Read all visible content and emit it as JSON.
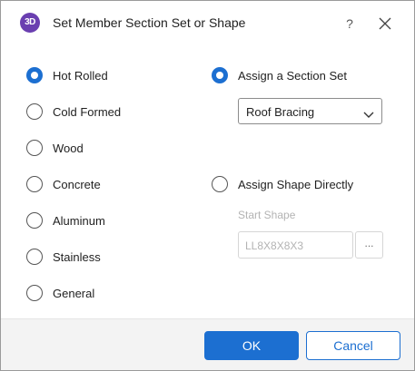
{
  "window": {
    "app_icon_text": "3D",
    "title": "Set Member Section Set or Shape",
    "help_label": "?"
  },
  "material_options": [
    {
      "label": "Hot Rolled",
      "checked": true
    },
    {
      "label": "Cold Formed",
      "checked": false
    },
    {
      "label": "Wood",
      "checked": false
    },
    {
      "label": "Concrete",
      "checked": false
    },
    {
      "label": "Aluminum",
      "checked": false
    },
    {
      "label": "Stainless",
      "checked": false
    },
    {
      "label": "General",
      "checked": false
    }
  ],
  "assign_section_set": {
    "label": "Assign a Section Set",
    "checked": true,
    "selected_value": "Roof Bracing"
  },
  "assign_shape_directly": {
    "label": "Assign Shape Directly",
    "checked": false,
    "start_shape_label": "Start Shape",
    "start_shape_value": "LL8X8X8X3",
    "browse_label": "..."
  },
  "footer": {
    "ok_label": "OK",
    "cancel_label": "Cancel"
  },
  "colors": {
    "accent": "#1c6fd1",
    "app_icon": "#6a3fb0",
    "disabled_text": "#b3b3b3",
    "footer_bg": "#f3f3f3"
  }
}
